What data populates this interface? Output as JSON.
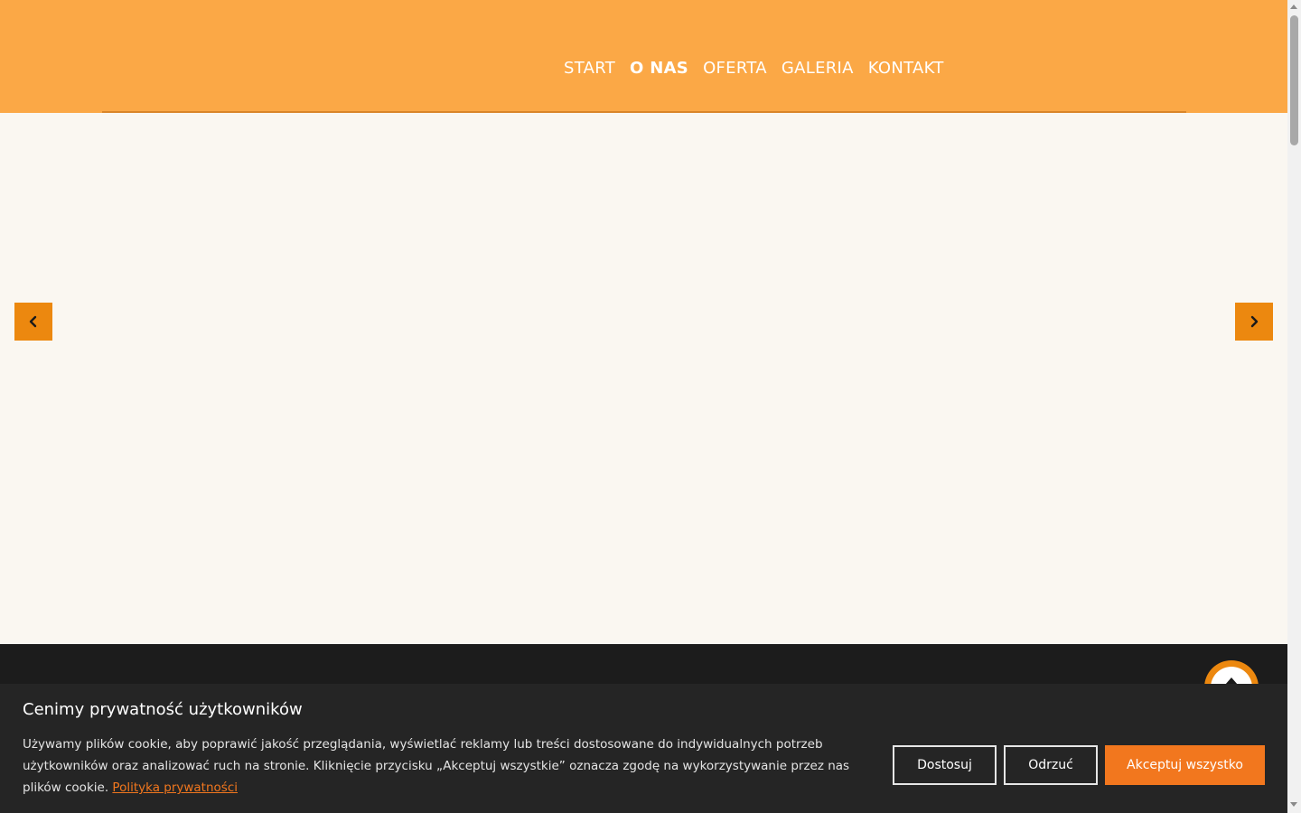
{
  "nav": {
    "items": [
      {
        "label": "START"
      },
      {
        "label": "O NAS"
      },
      {
        "label": "OFERTA"
      },
      {
        "label": "GALERIA"
      },
      {
        "label": "KONTAKT"
      }
    ],
    "active": "O NAS"
  },
  "slider": {
    "prev_icon": "chevron-left-icon",
    "next_icon": "chevron-right-icon"
  },
  "cookie": {
    "title": "Cenimy prywatność użytkowników",
    "text": "Używamy plików cookie, aby poprawić jakość przeglądania, wyświetlać reklamy lub treści dostosowane do indywidualnych potrzeb użytkowników oraz analizować ruch na stronie. Kliknięcie przycisku „Akceptuj wszystkie” oznacza zgodę na wykorzystywanie przez nas plików cookie.",
    "policy_link": "Polityka prywatności",
    "buttons": {
      "customize": "Dostosuj",
      "reject": "Odrzuć",
      "accept": "Akceptuj wszystko"
    }
  },
  "scroll_top_icon": "arrow-up-icon",
  "colors": {
    "header": "#fba846",
    "accent": "#ec880f",
    "accept_button": "#f2771e",
    "footer": "#1c1c1c",
    "cookie_bg": "#252525",
    "page_bg": "#faf7f1"
  }
}
